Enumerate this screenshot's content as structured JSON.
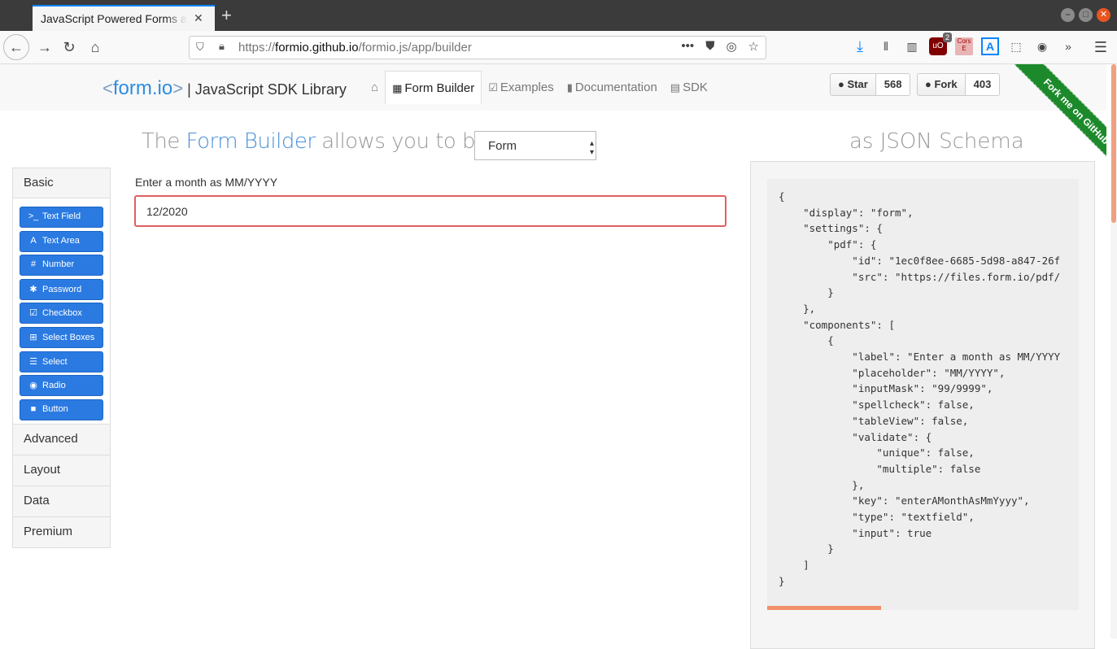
{
  "browser": {
    "tab_title": "JavaScript Powered Forms a",
    "url_prefix": "https://",
    "url_host": "formio.github.io",
    "url_path": "/formio.js/app/builder",
    "ublock_count": "2",
    "cors_label": "Cors E",
    "at_label": "A"
  },
  "nav": {
    "brand_lt": "<",
    "brand_name": "form.io",
    "brand_gt": ">",
    "brand_rest": " | JavaScript SDK Library",
    "links": [
      {
        "label": "Form Builder",
        "icon": "table-icon"
      },
      {
        "label": "Examples",
        "icon": "check-square-icon"
      },
      {
        "label": "Documentation",
        "icon": "book-icon"
      },
      {
        "label": "SDK",
        "icon": "list-alt-icon"
      }
    ],
    "star_label": "Star",
    "star_count": "568",
    "fork_label": "Fork",
    "fork_count": "403",
    "ribbon": "Fork me on GitHub"
  },
  "heading": {
    "pre": "The ",
    "accent": "Form Builder",
    "post": " allows you to build a",
    "select_value": "Form",
    "json_title": "as JSON Schema"
  },
  "sidebar": {
    "basic_title": "Basic",
    "components": [
      {
        "label": "Text Field",
        "glyph": ">_"
      },
      {
        "label": "Text Area",
        "glyph": "A"
      },
      {
        "label": "Number",
        "glyph": "#"
      },
      {
        "label": "Password",
        "glyph": "✱"
      },
      {
        "label": "Checkbox",
        "glyph": "☑"
      },
      {
        "label": "Select Boxes",
        "glyph": "⊞"
      },
      {
        "label": "Select",
        "glyph": "☰"
      },
      {
        "label": "Radio",
        "glyph": "◉"
      },
      {
        "label": "Button",
        "glyph": "■"
      }
    ],
    "groups": [
      "Advanced",
      "Layout",
      "Data",
      "Premium"
    ]
  },
  "form": {
    "field_label": "Enter a month as MM/YYYY",
    "field_value": "12/2020"
  },
  "json_text": "{\n    \"display\": \"form\",\n    \"settings\": {\n        \"pdf\": {\n            \"id\": \"1ec0f8ee-6685-5d98-a847-26f\n            \"src\": \"https://files.form.io/pdf/\n        }\n    },\n    \"components\": [\n        {\n            \"label\": \"Enter a month as MM/YYYY\n            \"placeholder\": \"MM/YYYY\",\n            \"inputMask\": \"99/9999\",\n            \"spellcheck\": false,\n            \"tableView\": false,\n            \"validate\": {\n                \"unique\": false,\n                \"multiple\": false\n            },\n            \"key\": \"enterAMonthAsMmYyyy\",\n            \"type\": \"textfield\",\n            \"input\": true\n        }\n    ]\n}"
}
